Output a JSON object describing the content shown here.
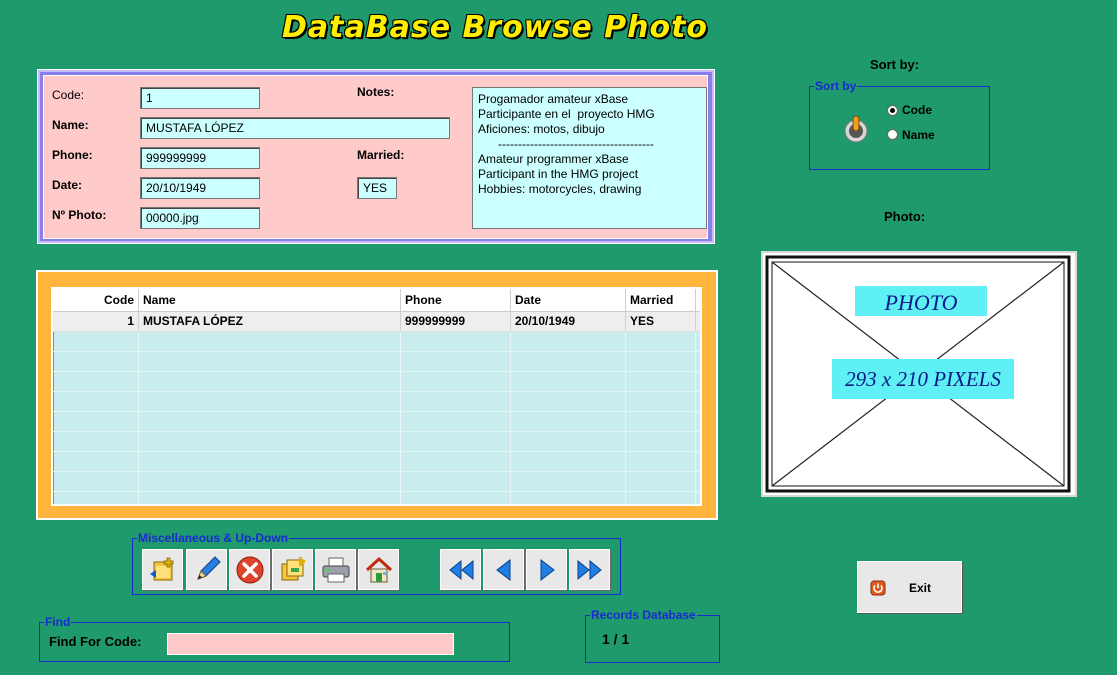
{
  "window": {
    "title": "DataBase Browse Photo"
  },
  "record": {
    "code_label": "Code:",
    "code_value": "1",
    "name_label": "Name:",
    "name_value": "MUSTAFA LÓPEZ",
    "phone_label": "Phone:",
    "phone_value": "999999999",
    "date_label": "Date:",
    "date_value": "20/10/1949",
    "photo_label": "Nº Photo:",
    "photo_value": "00000.jpg",
    "notes_label": "Notes:",
    "married_label": "Married:",
    "married_value": "YES",
    "notes_lines": [
      "Progamador amateur xBase",
      "Participante en el  proyecto HMG",
      "Aficiones: motos, dibujo",
      "      ---------------------------------------",
      "Amateur programmer xBase",
      "Participant in the HMG project",
      "Hobbies: motorcycles, drawing"
    ]
  },
  "grid": {
    "headers": {
      "code": "Code",
      "name": "Name",
      "phone": "Phone",
      "date": "Date",
      "married": "Married"
    },
    "rows": [
      {
        "code": "1",
        "name": "MUSTAFA LÓPEZ",
        "phone": "999999999",
        "date": "20/10/1949",
        "married": "YES"
      }
    ]
  },
  "toolbar": {
    "legend": "Miscellaneous & Up-Down",
    "buttons": [
      {
        "name": "new-record-icon"
      },
      {
        "name": "edit-pencil-icon"
      },
      {
        "name": "delete-icon"
      },
      {
        "name": "copy-record-icon"
      },
      {
        "name": "printer-icon"
      },
      {
        "name": "home-icon"
      },
      {
        "name": "first-record-icon"
      },
      {
        "name": "previous-record-icon"
      },
      {
        "name": "next-record-icon"
      },
      {
        "name": "last-record-icon"
      }
    ]
  },
  "find": {
    "legend": "Find",
    "label": "Find For Code:",
    "value": ""
  },
  "records": {
    "legend": "Records Database",
    "value": "1 / 1"
  },
  "sort": {
    "title": "Sort by:",
    "legend": "Sort by",
    "options": [
      "Code",
      "Name"
    ],
    "selected": "Code"
  },
  "photo": {
    "title": "Photo:",
    "placeholder_top": "PHOTO",
    "placeholder_bottom": "293 x 210 PIXELS"
  },
  "exit": {
    "label": "Exit"
  },
  "colors": {
    "background": "#1e9a6c",
    "title": "#ffee00",
    "record_panel": "#ffcaca",
    "record_border": "#8a80ea",
    "grid_panel": "#ffb43c",
    "field_bg": "#ccffff",
    "legend": "#1a2ad0"
  }
}
